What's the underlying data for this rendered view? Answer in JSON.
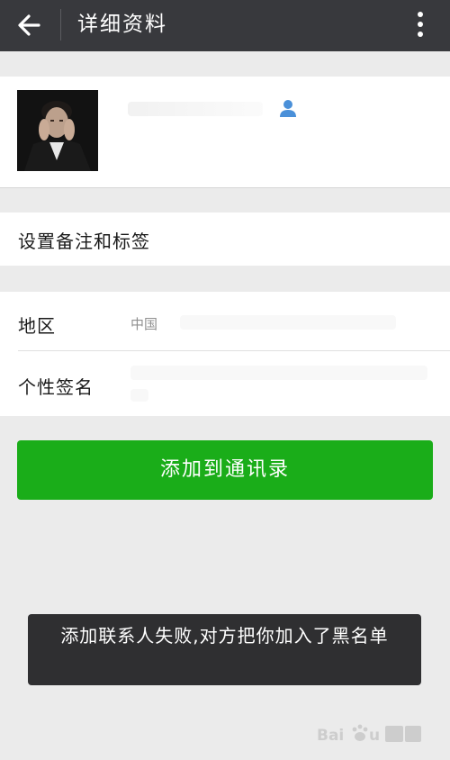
{
  "header": {
    "title": "详细资料",
    "back_icon": "arrow-left-icon",
    "more_icon": "more-vertical-icon"
  },
  "profile": {
    "avatar": "avatar-photo",
    "contact_icon": "person-icon"
  },
  "remark_row": {
    "label": "设置备注和标签"
  },
  "info": {
    "region_label": "地区",
    "region_value": "中国",
    "signature_label": "个性签名"
  },
  "add_button": {
    "label": "添加到通讯录"
  },
  "toast": {
    "message": "添加联系人失败,对方把你加入了黑名单"
  },
  "colors": {
    "header_bg": "#38393d",
    "page_bg": "#ebebeb",
    "button_green": "#1aad19",
    "toast_bg": "#2f2f31",
    "contact_icon_blue": "#4a90d9"
  }
}
